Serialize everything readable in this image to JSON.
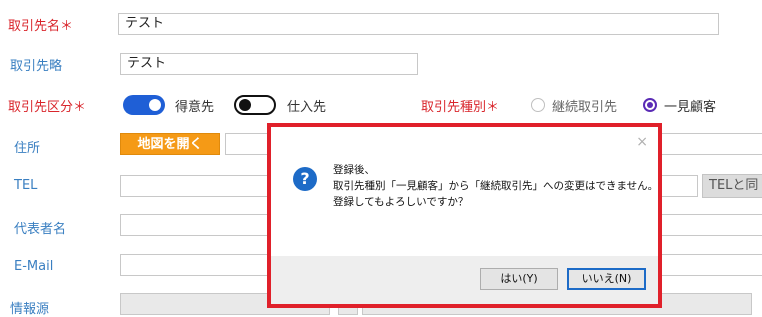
{
  "form": {
    "client_name": {
      "label": "取引先名＊",
      "value": "テスト"
    },
    "client_short": {
      "label": "取引先略",
      "value": "テスト"
    },
    "client_type": {
      "label": "取引先区分＊",
      "toggle1_label": "得意先",
      "toggle1_on": true,
      "toggle2_label": "仕入先",
      "toggle2_on": false
    },
    "client_category": {
      "label": "取引先種別＊",
      "options": [
        "継続取引先",
        "一見顧客"
      ],
      "selected": "一見顧客"
    },
    "address": {
      "label": "住所",
      "map_button": "地図を開く"
    },
    "tel": {
      "label": "TEL",
      "same_button": "TELと同"
    },
    "representative": {
      "label": "代表者名"
    },
    "email": {
      "label": "E-Mail"
    },
    "source": {
      "label": "情報源"
    }
  },
  "dialog": {
    "icon": "question-icon",
    "close_glyph": "×",
    "message_lines": [
      "登録後、",
      "取引先種別「一見顧客」から「継続取引先」への変更はできません。",
      "登録してもよろしいですか？"
    ],
    "yes_label": "はい(Y)",
    "no_label": "いいえ(N)"
  },
  "colors": {
    "required_label": "#d9262c",
    "optional_label": "#3a7fc1",
    "toggle_on": "#1f5fd6",
    "radio_selected": "#5a2bb5",
    "map_button": "#f59a16",
    "dialog_highlight": "#e0202a",
    "question_icon": "#1d6bc7"
  }
}
